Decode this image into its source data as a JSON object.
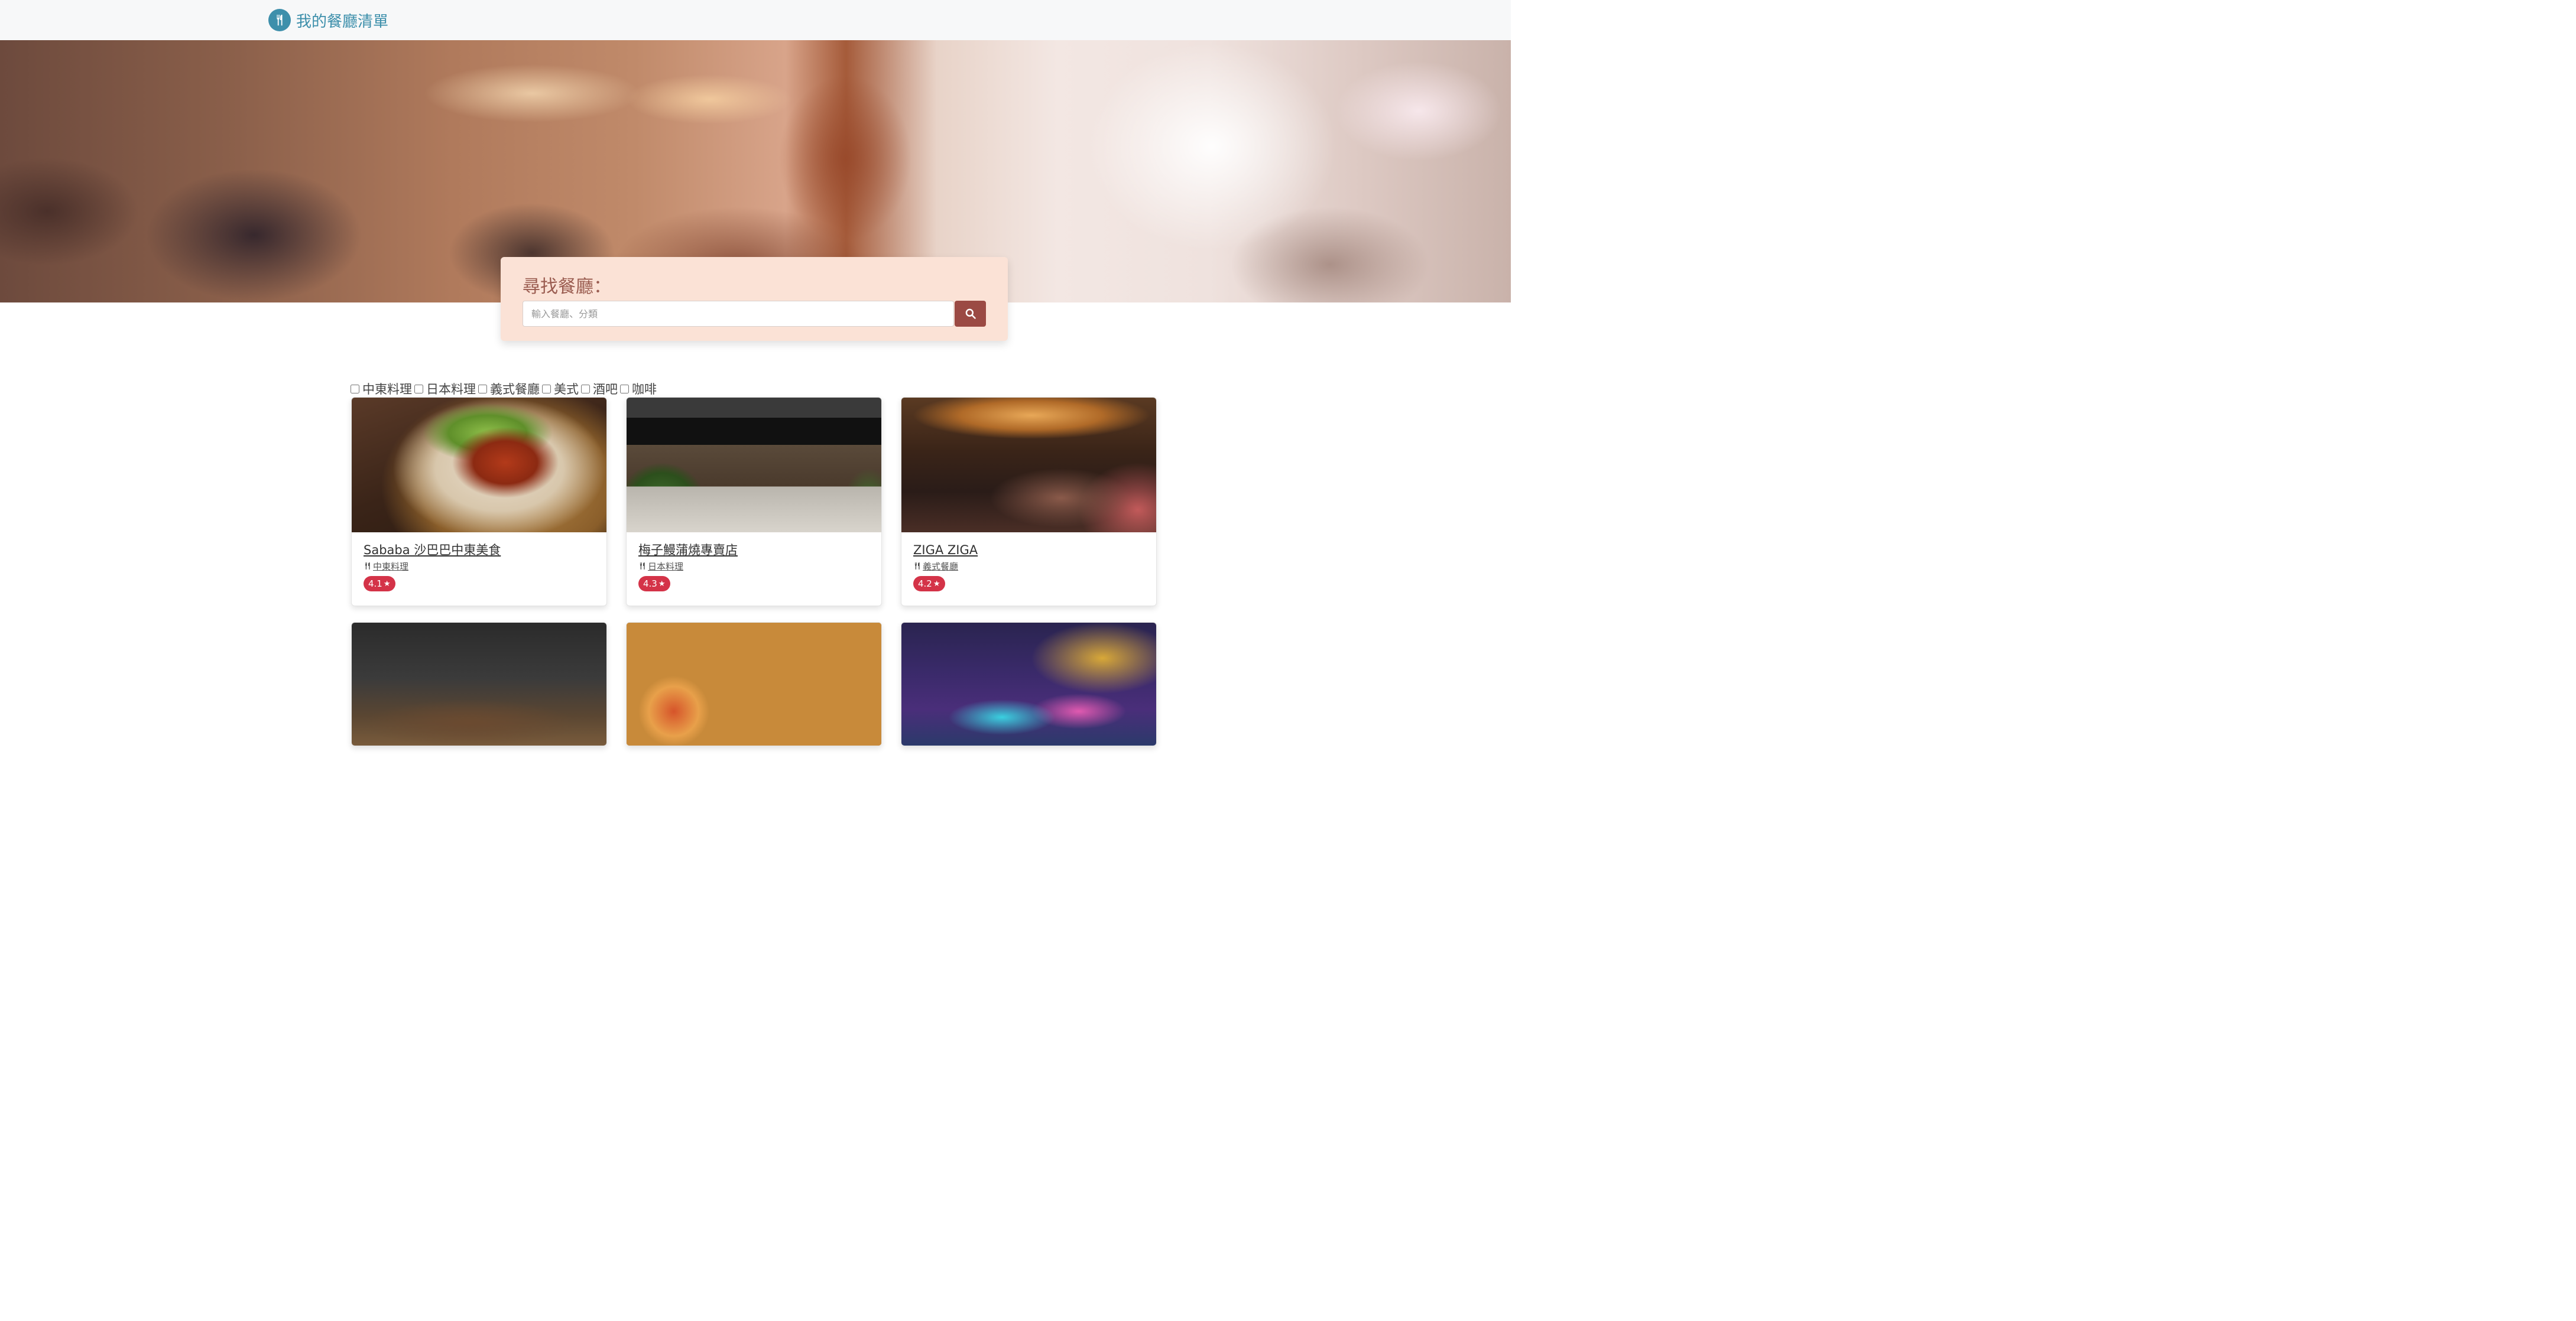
{
  "navbar": {
    "brand_text": "我的餐廳清單",
    "logo_icon": "utensils-icon",
    "brand_color": "#3d8fab"
  },
  "search": {
    "title": "尋找餐廳：",
    "placeholder": "輸入餐廳、分類",
    "value": "",
    "button_icon": "search-icon",
    "button_color": "#9b4a44",
    "card_color": "#fbe2d6"
  },
  "filters": [
    {
      "label": "中東料理",
      "checked": false
    },
    {
      "label": "日本料理",
      "checked": false
    },
    {
      "label": "義式餐廳",
      "checked": false
    },
    {
      "label": "美式",
      "checked": false
    },
    {
      "label": "酒吧",
      "checked": false
    },
    {
      "label": "咖啡",
      "checked": false
    }
  ],
  "restaurants": [
    {
      "name": "Sababa 沙巴巴中東美食",
      "category": "中東料理",
      "rating": "4.1"
    },
    {
      "name": "梅子鰻蒲燒專賣店",
      "category": "日本料理",
      "rating": "4.3"
    },
    {
      "name": "ZIGA ZIGA",
      "category": "義式餐廳",
      "rating": "4.2"
    }
  ],
  "rating_badge_color": "#d43348"
}
